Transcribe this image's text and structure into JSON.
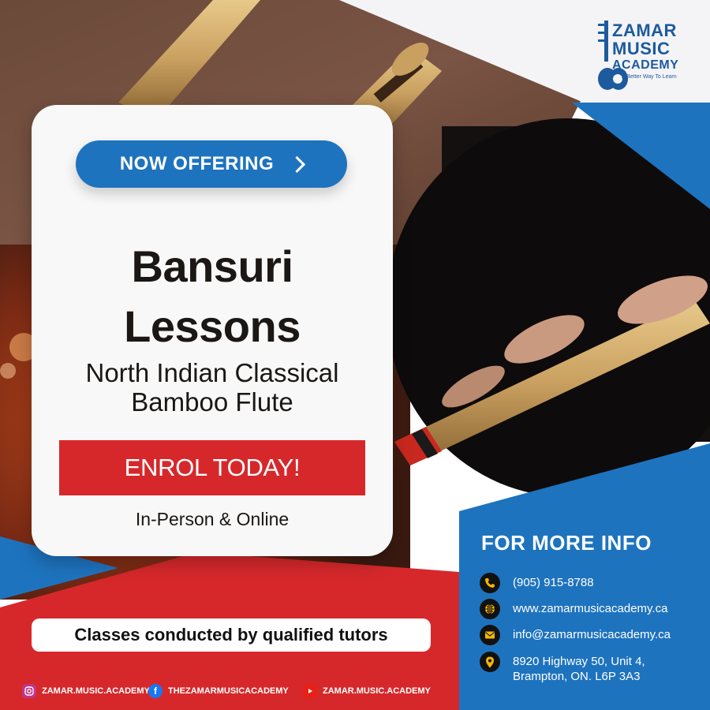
{
  "brand": {
    "name_line1": "ZAMAR",
    "name_line2": "MUSIC",
    "name_line3": "ACADEMY",
    "tagline": "A Better Way To Learn"
  },
  "card": {
    "badge": "NOW OFFERING",
    "badge_icon": "chevron-right-icon",
    "title_line1": "Bansuri",
    "title_line2": "Lessons",
    "subtitle_line1": "North Indian Classical",
    "subtitle_line2": "Bamboo Flute",
    "cta": "ENROL TODAY!",
    "modes": "In-Person & Online"
  },
  "tutors_banner": "Classes conducted by qualified tutors",
  "social": [
    {
      "platform": "instagram",
      "icon": "instagram-icon",
      "handle": "ZAMAR.MUSIC.ACADEMY"
    },
    {
      "platform": "facebook",
      "icon": "facebook-icon",
      "handle": "THEZAMARMUSICACADEMY"
    },
    {
      "platform": "youtube",
      "icon": "youtube-icon",
      "handle": "ZAMAR.MUSIC.ACADEMY"
    }
  ],
  "info": {
    "heading": "FOR MORE INFO",
    "phone": "(905) 915-8788",
    "website": "www.zamarmusicacademy.ca",
    "email": "info@zamarmusicacademy.ca",
    "address_line1": "8920 Highway 50, Unit 4,",
    "address_line2": "Brampton, ON. L6P 3A3"
  },
  "colors": {
    "brand_blue": "#1e73be",
    "accent_red": "#d6282b",
    "icon_gold": "#f2b705",
    "text_dark": "#1a1714"
  }
}
